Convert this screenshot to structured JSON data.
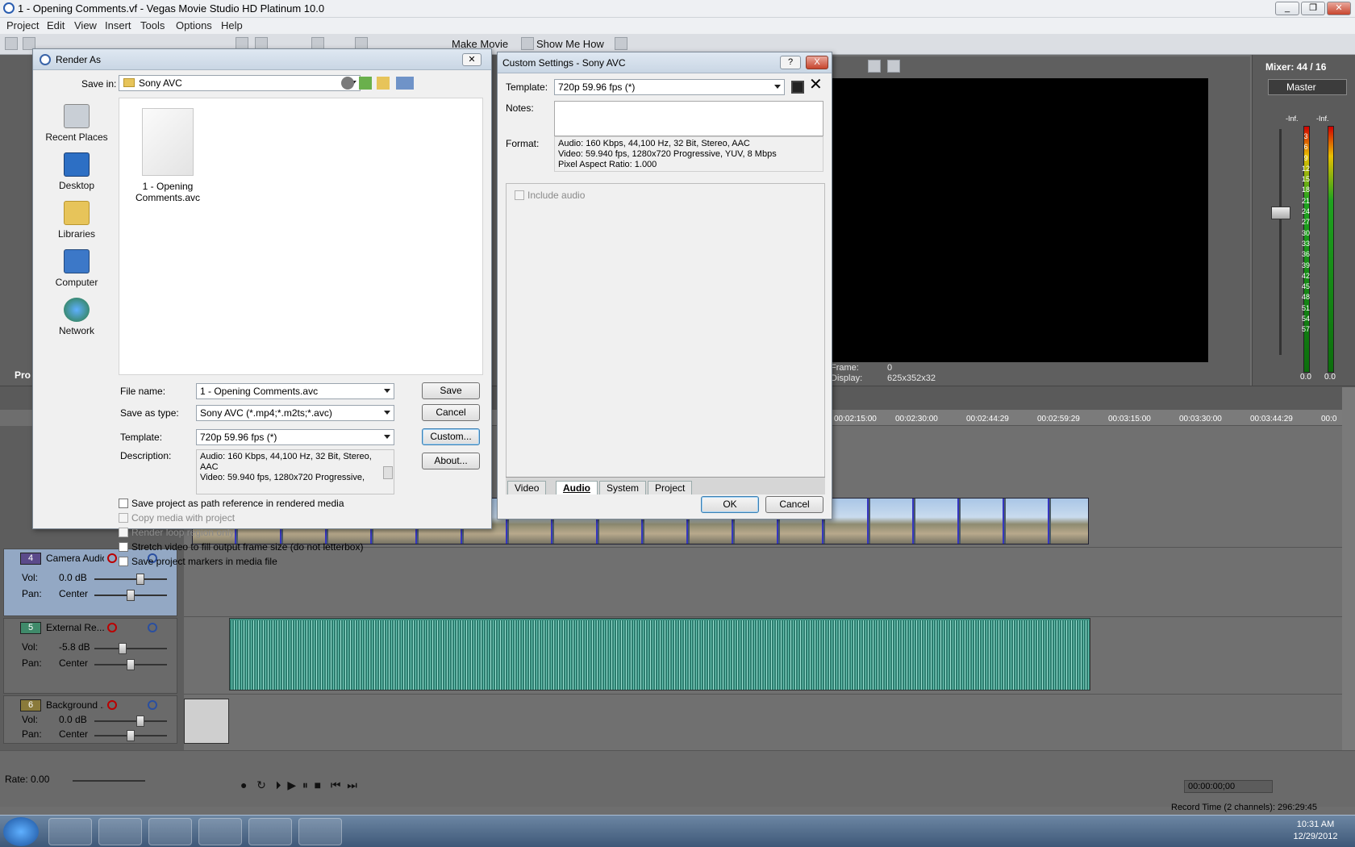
{
  "app": {
    "title": "1 - Opening Comments.vf - Vegas Movie Studio HD Platinum 10.0",
    "menus": [
      "Project",
      "Edit",
      "View",
      "Insert",
      "Tools",
      "Options",
      "Help"
    ],
    "toolbar": {
      "make_movie": "Make Movie",
      "show_me_how": "Show Me How"
    },
    "side_tab": "Pro"
  },
  "render_as": {
    "title": "Render As",
    "save_in_label": "Save in:",
    "save_in_value": "Sony AVC",
    "places": [
      "Recent Places",
      "Desktop",
      "Libraries",
      "Computer",
      "Network"
    ],
    "file_item": "1 - Opening Comments.avc",
    "file_name_label": "File name:",
    "file_name_value": "1 - Opening Comments.avc",
    "save_type_label": "Save as type:",
    "save_type_value": "Sony AVC (*.mp4;*.m2ts;*.avc)",
    "template_label": "Template:",
    "template_value": "720p 59.96 fps (*)",
    "description_label": "Description:",
    "description_line1": "Audio: 160 Kbps, 44,100 Hz, 32 Bit, Stereo,",
    "description_line2": "AAC",
    "description_line3": "Video: 59.940 fps, 1280x720 Progressive,",
    "buttons": {
      "save": "Save",
      "cancel": "Cancel",
      "custom": "Custom...",
      "about": "About..."
    },
    "checkboxes": [
      {
        "label": "Save project as path reference in rendered media",
        "enabled": true
      },
      {
        "label": "Copy media with project",
        "enabled": false
      },
      {
        "label": "Render loop region only",
        "enabled": false
      },
      {
        "label": "Stretch video to fill output frame size (do not letterbox)",
        "enabled": true
      },
      {
        "label": "Save project markers in media file",
        "enabled": true
      }
    ]
  },
  "custom_settings": {
    "title": "Custom Settings - Sony AVC",
    "help_btn": "?",
    "close_btn": "X",
    "template_label": "Template:",
    "template_value": "720p 59.96 fps (*)",
    "notes_label": "Notes:",
    "format_label": "Format:",
    "format_line1": "Audio: 160 Kbps, 44,100 Hz, 32 Bit, Stereo, AAC",
    "format_line2": "Video: 59.940 fps, 1280x720 Progressive, YUV, 8 Mbps",
    "format_line3": "Pixel Aspect Ratio: 1.000",
    "include_audio": "Include audio",
    "tabs": [
      "Video",
      "Audio",
      "System",
      "Project"
    ],
    "active_tab": "Audio",
    "ok": "OK",
    "cancel": "Cancel"
  },
  "preview": {
    "frame_label": "Frame:",
    "frame_value": "0",
    "display_label": "Display:",
    "display_value": "625x352x32"
  },
  "mixer": {
    "title": "Mixer: 44 / 16",
    "master": "Master",
    "inf_left": "-Inf.",
    "inf_right": "-Inf.",
    "scale": [
      "3",
      "6",
      "9",
      "12",
      "15",
      "18",
      "21",
      "24",
      "27",
      "30",
      "33",
      "36",
      "39",
      "42",
      "45",
      "48",
      "51",
      "54",
      "57"
    ],
    "bottom_left": "0.0",
    "bottom_right": "0.0"
  },
  "ruler": [
    "00:02:15:00",
    "00:02:30:00",
    "00:02:44:29",
    "00:02:59:29",
    "00:03:15:00",
    "00:03:30:00",
    "00:03:44:29",
    "00:0"
  ],
  "tracks": [
    {
      "num": "4",
      "name": "Camera Audio",
      "vol": "0.0 dB",
      "pan": "Center",
      "color": "#5b4a8a",
      "vol_level": 0.72
    },
    {
      "num": "5",
      "name": "External Re...",
      "vol": "-5.8 dB",
      "pan": "Center",
      "color": "#3f8a6a",
      "vol_level": 0.45
    },
    {
      "num": "6",
      "name": "Background ...",
      "vol": "0.0 dB",
      "pan": "Center",
      "color": "#8a7a3a",
      "vol_level": 0.72
    }
  ],
  "track_labels": {
    "vol": "Vol:",
    "pan": "Pan:"
  },
  "transport": {
    "rate": "Rate: 0.00",
    "timecode": "00:00:00;00",
    "record_time": "Record Time (2 channels): 296:29:45"
  },
  "taskbar": {
    "time": "10:31 AM",
    "date": "12/29/2012"
  },
  "colors": {
    "accent": "#3399ff",
    "audio_wave": "#3a8f80"
  }
}
